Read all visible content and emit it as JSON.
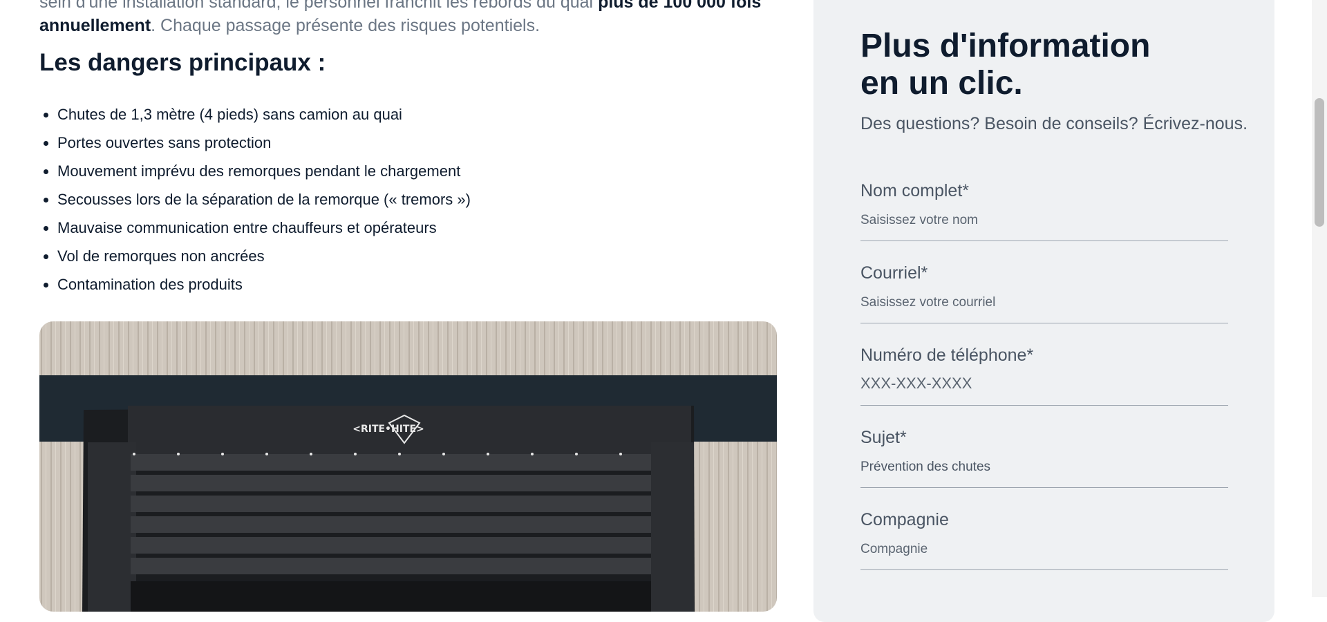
{
  "intro": {
    "text_before": "sein d'une installation standard, le personnel franchit les rebords du quai ",
    "text_bold": "plus de 100 000 fois annuellement",
    "text_after": ". Chaque passage présente des risques potentiels."
  },
  "dangers": {
    "title": "Les dangers principaux :",
    "items": [
      "Chutes de 1,3 mètre (4 pieds) sans camion au quai",
      "Portes ouvertes sans protection",
      "Mouvement imprévu des remorques pendant le chargement",
      "Secousses lors de la séparation de la remorque (« tremors »)",
      "Mauvaise communication entre chauffeurs et opérateurs",
      "Vol de remorques non ancrées",
      "Contamination des produits"
    ]
  },
  "image": {
    "brand_text": "<RITE•HITE>"
  },
  "form": {
    "title_line1": "Plus d'information",
    "title_line2": "en un clic.",
    "subtitle": "Des questions? Besoin de conseils? Écrivez-nous.",
    "fields": [
      {
        "label": "Nom complet*",
        "placeholder": "Saisissez votre nom"
      },
      {
        "label": "Courriel*",
        "placeholder": "Saisissez votre courriel"
      },
      {
        "label": "Numéro de téléphone*",
        "placeholder": "XXX-XXX-XXXX"
      },
      {
        "label": "Sujet*",
        "value": "Prévention des chutes"
      },
      {
        "label": "Compagnie",
        "placeholder": "Compagnie"
      }
    ]
  },
  "colors": {
    "text_dark": "#0f1c2e",
    "text_muted": "#6b7684",
    "panel_bg": "#eff1f3"
  }
}
